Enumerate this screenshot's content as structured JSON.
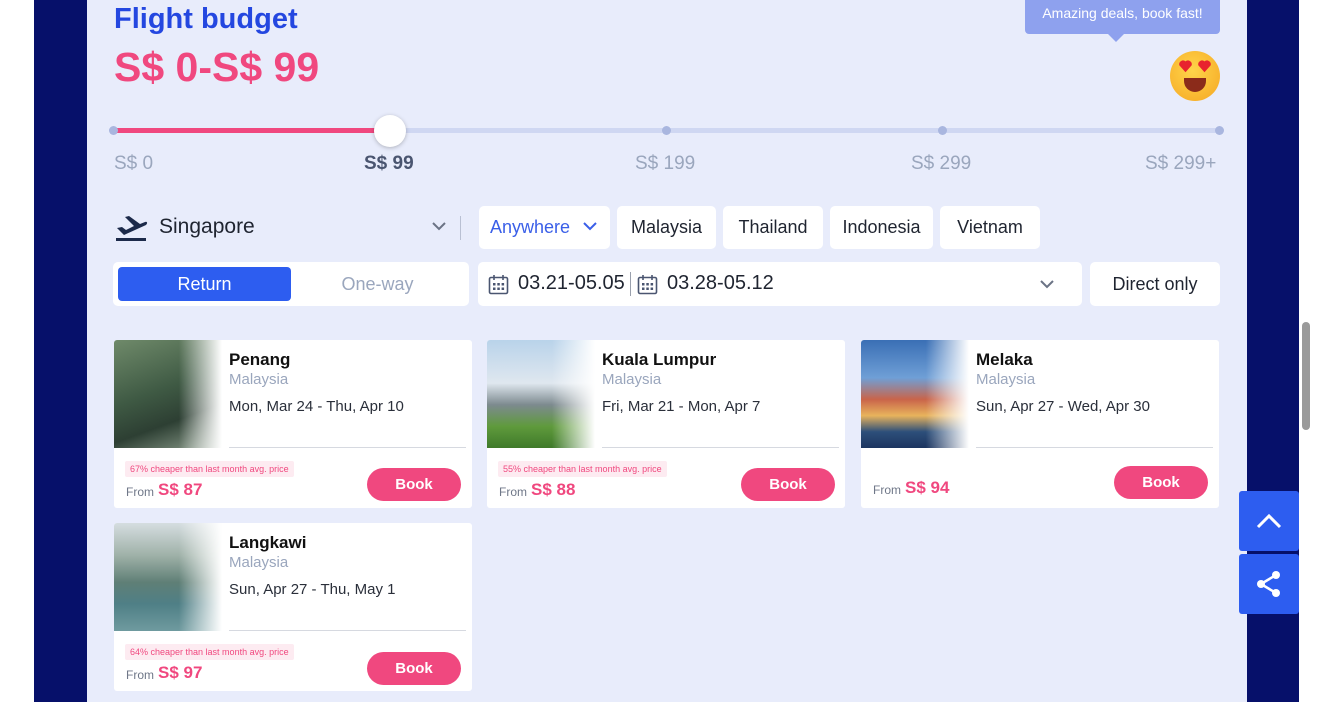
{
  "header": {
    "title": "Flight budget",
    "range": "S$ 0-S$ 99",
    "tooltip": "Amazing deals, book fast!"
  },
  "slider": {
    "value_fraction": 0.25,
    "ticks": [
      "S$ 0",
      "S$ 99",
      "S$ 199",
      "S$ 299",
      "S$ 299+"
    ],
    "active_tick": "S$ 99"
  },
  "origin": {
    "city": "Singapore"
  },
  "destinations": {
    "selected": "Anywhere",
    "chips": [
      "Malaysia",
      "Thailand",
      "Indonesia",
      "Vietnam"
    ]
  },
  "trip_type": {
    "return": "Return",
    "one_way": "One-way",
    "selected": "Return"
  },
  "dates": {
    "depart": "03.21-05.05",
    "return": "03.28-05.12"
  },
  "filter": {
    "direct_only": "Direct only"
  },
  "deals": [
    {
      "city": "Penang",
      "country": "Malaysia",
      "dates": "Mon, Mar 24 - Thu, Apr 10",
      "cheaper": "67% cheaper than last month avg. price",
      "from": "From",
      "price": "S$ 87",
      "book": "Book"
    },
    {
      "city": "Kuala Lumpur",
      "country": "Malaysia",
      "dates": "Fri, Mar 21 - Mon, Apr 7",
      "cheaper": "55% cheaper than last month avg. price",
      "from": "From",
      "price": "S$ 88",
      "book": "Book"
    },
    {
      "city": "Melaka",
      "country": "Malaysia",
      "dates": "Sun, Apr 27 - Wed, Apr 30",
      "cheaper": "",
      "from": "From",
      "price": "S$ 94",
      "book": "Book"
    },
    {
      "city": "Langkawi",
      "country": "Malaysia",
      "dates": "Sun, Apr 27 - Thu, May 1",
      "cheaper": "64% cheaper than last month avg. price",
      "from": "From",
      "price": "S$ 97",
      "book": "Book"
    }
  ],
  "colors": {
    "accent": "#2d5df0",
    "price": "#f0487f",
    "panel": "#e8ecfb",
    "frame": "#06106a"
  },
  "icons": [
    "plane-takeoff-icon",
    "chevron-down-icon",
    "calendar-icon",
    "chevron-up-icon",
    "share-icon",
    "heart-eyes-emoji-icon"
  ]
}
